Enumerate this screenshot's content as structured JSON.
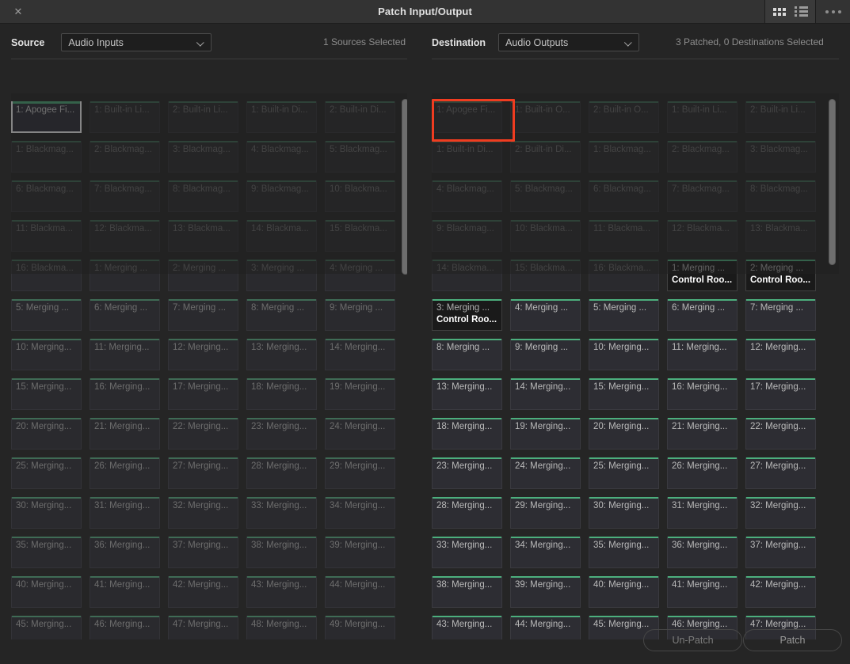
{
  "window": {
    "title": "Patch Input/Output",
    "close_icon": "close-icon",
    "grid_view_icon": "grid-view-icon",
    "list_view_icon": "list-view-icon",
    "more_icon": "more-options-icon"
  },
  "source": {
    "label": "Source",
    "dropdown_value": "Audio Inputs",
    "status": "1 Sources Selected",
    "tiles": [
      {
        "l1": "1: Apogee Fi...",
        "state": "selected"
      },
      {
        "l1": "1: Built-in Li...",
        "state": "dim"
      },
      {
        "l1": "2: Built-in Li...",
        "state": "dim"
      },
      {
        "l1": "1: Built-in Di...",
        "state": "dim"
      },
      {
        "l1": "2: Built-in Di...",
        "state": "dim"
      },
      {
        "l1": "1: Blackmag...",
        "state": "dim"
      },
      {
        "l1": "2: Blackmag...",
        "state": "dim"
      },
      {
        "l1": "3: Blackmag...",
        "state": "dim"
      },
      {
        "l1": "4: Blackmag...",
        "state": "dim"
      },
      {
        "l1": "5: Blackmag...",
        "state": "dim"
      },
      {
        "l1": "6: Blackmag...",
        "state": "dim"
      },
      {
        "l1": "7: Blackmag...",
        "state": "dim"
      },
      {
        "l1": "8: Blackmag...",
        "state": "dim"
      },
      {
        "l1": "9: Blackmag...",
        "state": "dim"
      },
      {
        "l1": "10: Blackma...",
        "state": "dim"
      },
      {
        "l1": "11: Blackma...",
        "state": "dim"
      },
      {
        "l1": "12: Blackma...",
        "state": "dim"
      },
      {
        "l1": "13: Blackma...",
        "state": "dim"
      },
      {
        "l1": "14: Blackma...",
        "state": "dim"
      },
      {
        "l1": "15: Blackma...",
        "state": "dim"
      },
      {
        "l1": "16: Blackma...",
        "state": "dim"
      },
      {
        "l1": "1: Merging ...",
        "state": "dim"
      },
      {
        "l1": "2: Merging ...",
        "state": "dim"
      },
      {
        "l1": "3: Merging ...",
        "state": "dim"
      },
      {
        "l1": "4: Merging ...",
        "state": "dim"
      },
      {
        "l1": "5: Merging ...",
        "state": "dim"
      },
      {
        "l1": "6: Merging ...",
        "state": "dim"
      },
      {
        "l1": "7: Merging ...",
        "state": "dim"
      },
      {
        "l1": "8: Merging ...",
        "state": "dim"
      },
      {
        "l1": "9: Merging ...",
        "state": "dim"
      },
      {
        "l1": "10: Merging...",
        "state": "dim"
      },
      {
        "l1": "11: Merging...",
        "state": "dim"
      },
      {
        "l1": "12: Merging...",
        "state": "dim"
      },
      {
        "l1": "13: Merging...",
        "state": "dim"
      },
      {
        "l1": "14: Merging...",
        "state": "dim"
      },
      {
        "l1": "15: Merging...",
        "state": "dim"
      },
      {
        "l1": "16: Merging...",
        "state": "dim"
      },
      {
        "l1": "17: Merging...",
        "state": "dim"
      },
      {
        "l1": "18: Merging...",
        "state": "dim"
      },
      {
        "l1": "19: Merging...",
        "state": "dim"
      },
      {
        "l1": "20: Merging...",
        "state": "dim"
      },
      {
        "l1": "21: Merging...",
        "state": "dim"
      },
      {
        "l1": "22: Merging...",
        "state": "dim"
      },
      {
        "l1": "23: Merging...",
        "state": "dim"
      },
      {
        "l1": "24: Merging...",
        "state": "dim"
      },
      {
        "l1": "25: Merging...",
        "state": "dim"
      },
      {
        "l1": "26: Merging...",
        "state": "dim"
      },
      {
        "l1": "27: Merging...",
        "state": "dim"
      },
      {
        "l1": "28: Merging...",
        "state": "dim"
      },
      {
        "l1": "29: Merging...",
        "state": "dim"
      },
      {
        "l1": "30: Merging...",
        "state": "dim"
      },
      {
        "l1": "31: Merging...",
        "state": "dim"
      },
      {
        "l1": "32: Merging...",
        "state": "dim"
      },
      {
        "l1": "33: Merging...",
        "state": "dim"
      },
      {
        "l1": "34: Merging...",
        "state": "dim"
      },
      {
        "l1": "35: Merging...",
        "state": "dim"
      },
      {
        "l1": "36: Merging...",
        "state": "dim"
      },
      {
        "l1": "37: Merging...",
        "state": "dim"
      },
      {
        "l1": "38: Merging...",
        "state": "dim"
      },
      {
        "l1": "39: Merging...",
        "state": "dim"
      },
      {
        "l1": "40: Merging...",
        "state": "dim"
      },
      {
        "l1": "41: Merging...",
        "state": "dim"
      },
      {
        "l1": "42: Merging...",
        "state": "dim"
      },
      {
        "l1": "43: Merging...",
        "state": "dim"
      },
      {
        "l1": "44: Merging...",
        "state": "dim"
      },
      {
        "l1": "45: Merging...",
        "state": "dim"
      },
      {
        "l1": "46: Merging...",
        "state": "dim"
      },
      {
        "l1": "47: Merging...",
        "state": "dim"
      },
      {
        "l1": "48: Merging...",
        "state": "dim"
      },
      {
        "l1": "49: Merging...",
        "state": "dim"
      }
    ]
  },
  "destination": {
    "label": "Destination",
    "dropdown_value": "Audio Outputs",
    "status": "3 Patched, 0 Destinations Selected",
    "cursor_icon": "destination-cursor",
    "tiles": [
      {
        "l1": "1: Apogee Fi...",
        "state": "dim"
      },
      {
        "l1": "1: Built-in O...",
        "state": "dim"
      },
      {
        "l1": "2: Built-in O...",
        "state": "dim"
      },
      {
        "l1": "1: Built-in Li...",
        "state": "dim"
      },
      {
        "l1": "2: Built-in Li...",
        "state": "dim"
      },
      {
        "l1": "1: Built-in Di...",
        "state": "dim"
      },
      {
        "l1": "2: Built-in Di...",
        "state": "dim"
      },
      {
        "l1": "1: Blackmag...",
        "state": "dim"
      },
      {
        "l1": "2: Blackmag...",
        "state": "dim"
      },
      {
        "l1": "3: Blackmag...",
        "state": "dim"
      },
      {
        "l1": "4: Blackmag...",
        "state": "dim"
      },
      {
        "l1": "5: Blackmag...",
        "state": "dim"
      },
      {
        "l1": "6: Blackmag...",
        "state": "dim"
      },
      {
        "l1": "7: Blackmag...",
        "state": "dim"
      },
      {
        "l1": "8: Blackmag...",
        "state": "dim"
      },
      {
        "l1": "9: Blackmag...",
        "state": "dim"
      },
      {
        "l1": "10: Blackma...",
        "state": "dim"
      },
      {
        "l1": "11: Blackma...",
        "state": "dim"
      },
      {
        "l1": "12: Blackma...",
        "state": "dim"
      },
      {
        "l1": "13: Blackma...",
        "state": "dim"
      },
      {
        "l1": "14: Blackma...",
        "state": "dim"
      },
      {
        "l1": "15: Blackma...",
        "state": "dim"
      },
      {
        "l1": "16: Blackma...",
        "state": "dim"
      },
      {
        "l1": "1: Merging ...",
        "l2": "Control Roo...",
        "state": "patched"
      },
      {
        "l1": "2: Merging ...",
        "l2": "Control Roo...",
        "state": "patched"
      },
      {
        "l1": "3: Merging ...",
        "l2": "Control Roo...",
        "state": "patched"
      },
      {
        "l1": "4: Merging ...",
        "state": "bright"
      },
      {
        "l1": "5: Merging ...",
        "state": "bright"
      },
      {
        "l1": "6: Merging ...",
        "state": "bright"
      },
      {
        "l1": "7: Merging ...",
        "state": "bright"
      },
      {
        "l1": "8: Merging ...",
        "state": "bright"
      },
      {
        "l1": "9: Merging ...",
        "state": "bright"
      },
      {
        "l1": "10: Merging...",
        "state": "bright"
      },
      {
        "l1": "11: Merging...",
        "state": "bright"
      },
      {
        "l1": "12: Merging...",
        "state": "bright"
      },
      {
        "l1": "13: Merging...",
        "state": "bright"
      },
      {
        "l1": "14: Merging...",
        "state": "bright"
      },
      {
        "l1": "15: Merging...",
        "state": "bright"
      },
      {
        "l1": "16: Merging...",
        "state": "bright"
      },
      {
        "l1": "17: Merging...",
        "state": "bright"
      },
      {
        "l1": "18: Merging...",
        "state": "bright"
      },
      {
        "l1": "19: Merging...",
        "state": "bright"
      },
      {
        "l1": "20: Merging...",
        "state": "bright"
      },
      {
        "l1": "21: Merging...",
        "state": "bright"
      },
      {
        "l1": "22: Merging...",
        "state": "bright"
      },
      {
        "l1": "23: Merging...",
        "state": "bright"
      },
      {
        "l1": "24: Merging...",
        "state": "bright"
      },
      {
        "l1": "25: Merging...",
        "state": "bright"
      },
      {
        "l1": "26: Merging...",
        "state": "bright"
      },
      {
        "l1": "27: Merging...",
        "state": "bright"
      },
      {
        "l1": "28: Merging...",
        "state": "bright"
      },
      {
        "l1": "29: Merging...",
        "state": "bright"
      },
      {
        "l1": "30: Merging...",
        "state": "bright"
      },
      {
        "l1": "31: Merging...",
        "state": "bright"
      },
      {
        "l1": "32: Merging...",
        "state": "bright"
      },
      {
        "l1": "33: Merging...",
        "state": "bright"
      },
      {
        "l1": "34: Merging...",
        "state": "bright"
      },
      {
        "l1": "35: Merging...",
        "state": "bright"
      },
      {
        "l1": "36: Merging...",
        "state": "bright"
      },
      {
        "l1": "37: Merging...",
        "state": "bright"
      },
      {
        "l1": "38: Merging...",
        "state": "bright"
      },
      {
        "l1": "39: Merging...",
        "state": "bright"
      },
      {
        "l1": "40: Merging...",
        "state": "bright"
      },
      {
        "l1": "41: Merging...",
        "state": "bright"
      },
      {
        "l1": "42: Merging...",
        "state": "bright"
      },
      {
        "l1": "43: Merging...",
        "state": "bright"
      },
      {
        "l1": "44: Merging...",
        "state": "bright"
      },
      {
        "l1": "45: Merging...",
        "state": "bright"
      },
      {
        "l1": "46: Merging...",
        "state": "bright"
      },
      {
        "l1": "47: Merging...",
        "state": "bright"
      }
    ]
  },
  "footer": {
    "unpatch_label": "Un-Patch",
    "patch_label": "Patch"
  },
  "colors": {
    "accent_green": "#4caf7d",
    "accent_green_dim": "#3f6b55",
    "cursor_red": "#f03c20",
    "window_bg": "#252525",
    "titlebar_bg": "#333333"
  }
}
